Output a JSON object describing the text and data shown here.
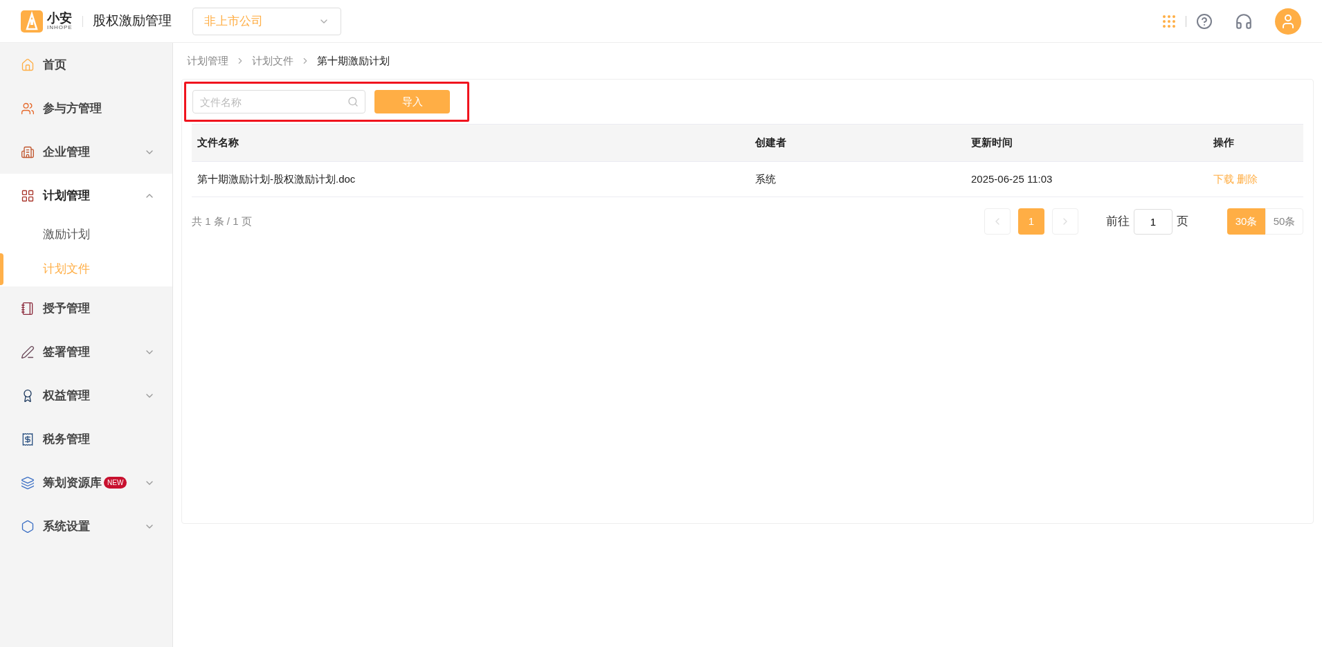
{
  "header": {
    "logo_text": "小安",
    "logo_subtext": "INHOPE",
    "app_title": "股权激励管理",
    "company_select": {
      "value": "非上市公司"
    }
  },
  "sidebar": {
    "items": [
      {
        "label": "首页",
        "has_children": false,
        "selected": false
      },
      {
        "label": "参与方管理",
        "has_children": false,
        "selected": false
      },
      {
        "label": "企业管理",
        "has_children": true,
        "expanded": false,
        "selected": false
      },
      {
        "label": "计划管理",
        "has_children": true,
        "expanded": true,
        "selected": true,
        "children": [
          {
            "label": "激励计划",
            "selected": false
          },
          {
            "label": "计划文件",
            "selected": true
          }
        ]
      },
      {
        "label": "授予管理",
        "has_children": false,
        "selected": false
      },
      {
        "label": "签署管理",
        "has_children": true,
        "expanded": false,
        "selected": false
      },
      {
        "label": "权益管理",
        "has_children": true,
        "expanded": false,
        "selected": false
      },
      {
        "label": "税务管理",
        "has_children": false,
        "selected": false
      },
      {
        "label": "筹划资源库",
        "has_children": true,
        "expanded": false,
        "selected": false,
        "badge": "NEW"
      },
      {
        "label": "系统设置",
        "has_children": true,
        "expanded": false,
        "selected": false
      }
    ]
  },
  "breadcrumb": [
    "计划管理",
    "计划文件",
    "第十期激励计划"
  ],
  "toolbar": {
    "search": {
      "placeholder": "文件名称"
    },
    "import_button": "导入"
  },
  "table": {
    "columns": [
      "文件名称",
      "创建者",
      "更新时间",
      "操作"
    ],
    "rows": [
      {
        "file_name": "第十期激励计划-股权激励计划.doc",
        "creator": "系统",
        "updated": "2025-06-25 11:03",
        "actions": [
          "下载",
          "删除"
        ]
      }
    ]
  },
  "pagination": {
    "summary": "共 1 条 / 1 页",
    "prev_disabled": true,
    "next_disabled": true,
    "pages": [
      {
        "label": "1",
        "selected": true
      }
    ],
    "goto_label": "前往",
    "goto_value": "1",
    "goto_suffix": "页",
    "page_sizes": [
      {
        "label": "30条",
        "selected": true
      },
      {
        "label": "50条",
        "selected": false
      }
    ]
  }
}
